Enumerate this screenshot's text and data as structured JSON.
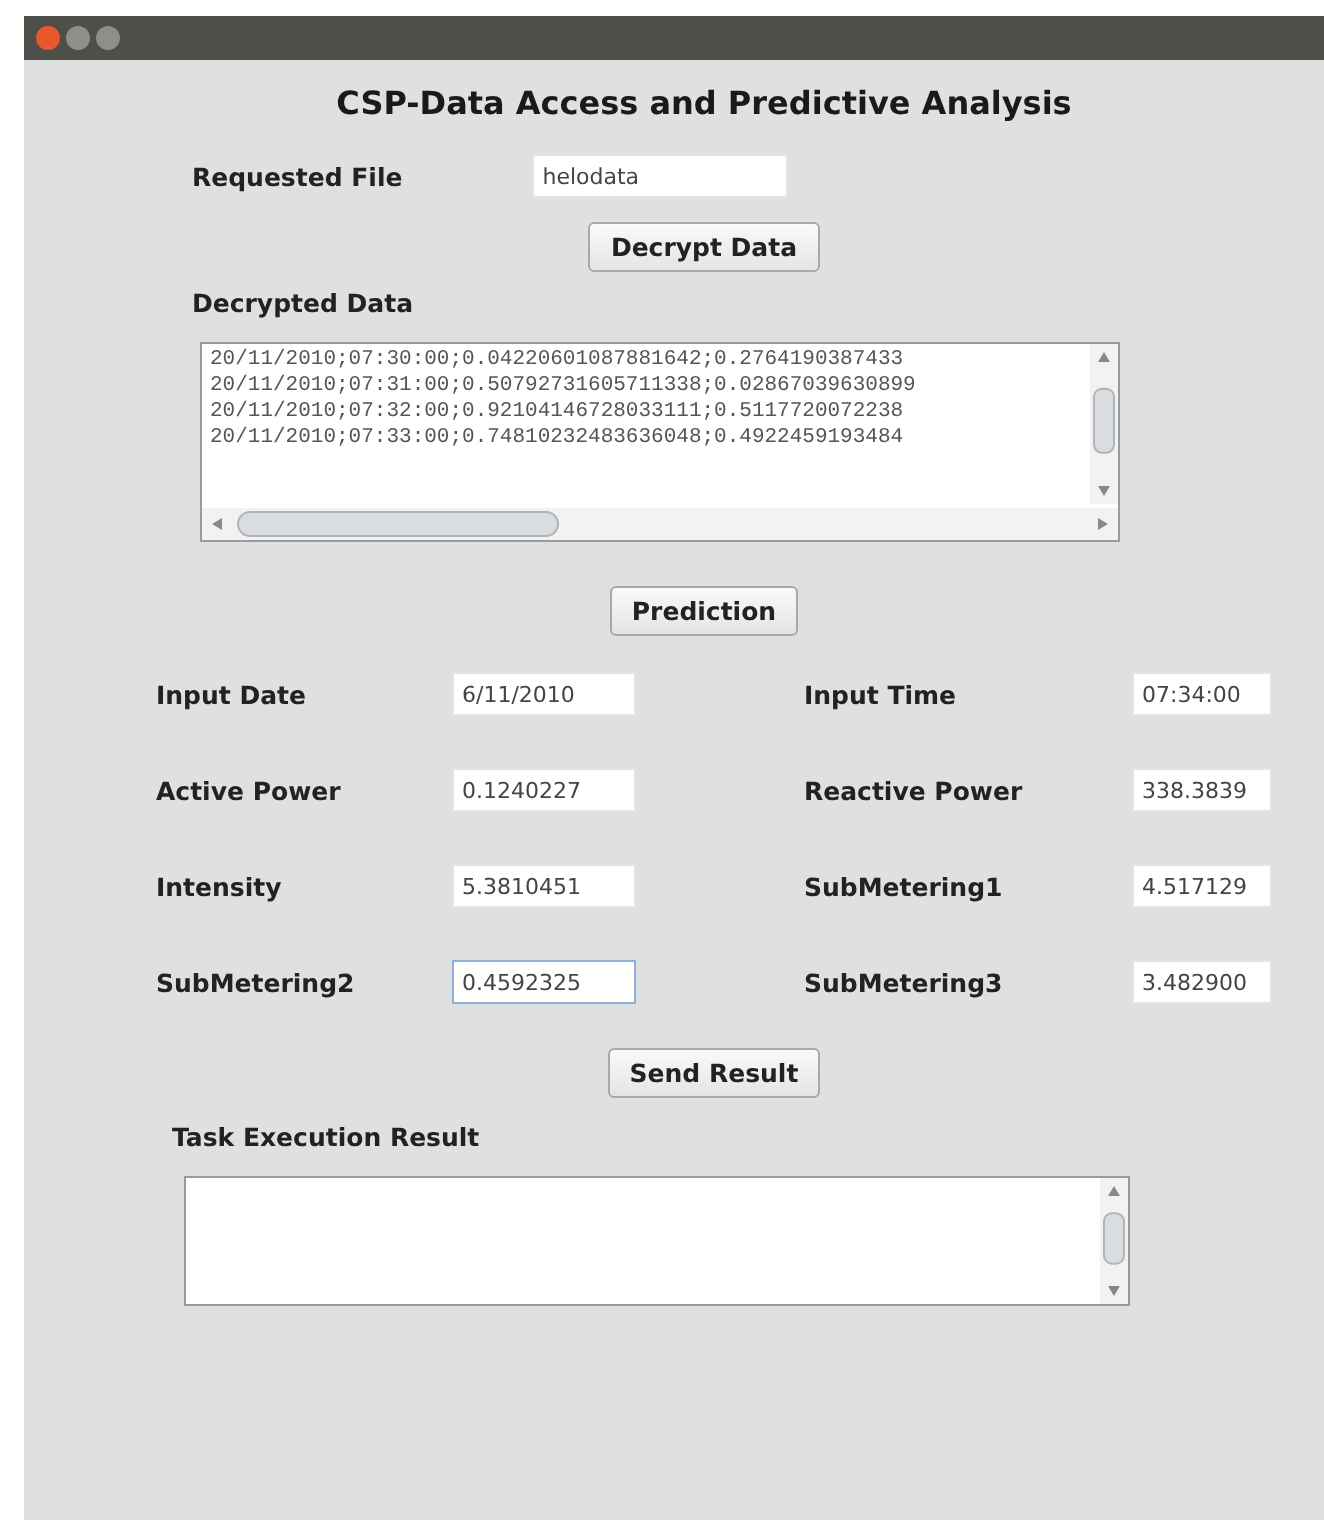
{
  "window": {
    "title": "CSP-Data Access and Predictive Analysis"
  },
  "request": {
    "label": "Requested File",
    "value": "helodata",
    "button": "Decrypt Data"
  },
  "decrypted": {
    "label": "Decrypted Data",
    "lines": [
      "20/11/2010;07:30:00;0.04220601087881642;0.2764190387433",
      "20/11/2010;07:31:00;0.50792731605711338;0.02867039630899",
      "20/11/2010;07:32:00;0.92104146728033111;0.5117720072238",
      "20/11/2010;07:33:00;0.74810232483636048;0.4922459193484"
    ]
  },
  "prediction_button": "Prediction",
  "fields": [
    {
      "label": "Input Date",
      "value": "6/11/2010",
      "focused": false
    },
    {
      "label": "Input Time",
      "value": "07:34:00",
      "focused": false
    },
    {
      "label": "Active Power",
      "value": "0.1240227",
      "focused": false
    },
    {
      "label": "Reactive Power",
      "value": "338.3839",
      "focused": false
    },
    {
      "label": "Intensity",
      "value": "5.3810451",
      "focused": false
    },
    {
      "label": "SubMetering1",
      "value": "4.517129",
      "focused": false
    },
    {
      "label": "SubMetering2",
      "value": "0.4592325",
      "focused": true
    },
    {
      "label": "SubMetering3",
      "value": "3.482900",
      "focused": false
    }
  ],
  "send_button": "Send Result",
  "result": {
    "label": "Task Execution Result"
  }
}
